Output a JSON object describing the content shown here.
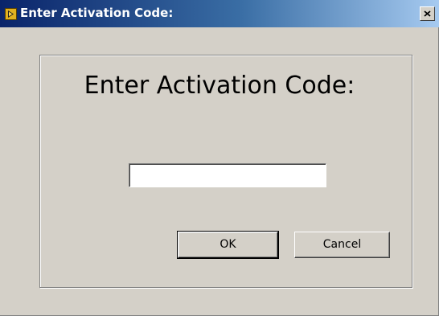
{
  "window": {
    "title": "Enter Activation Code:",
    "app_icon": "labview-run-icon",
    "close_icon": "close-icon",
    "colors": {
      "titlebar_start": "#0a246a",
      "titlebar_end": "#a6caf0",
      "face": "#d4d0c8"
    }
  },
  "dialog": {
    "heading": "Enter Activation Code:",
    "activation_code_value": "",
    "ok_label": "OK",
    "cancel_label": "Cancel"
  }
}
